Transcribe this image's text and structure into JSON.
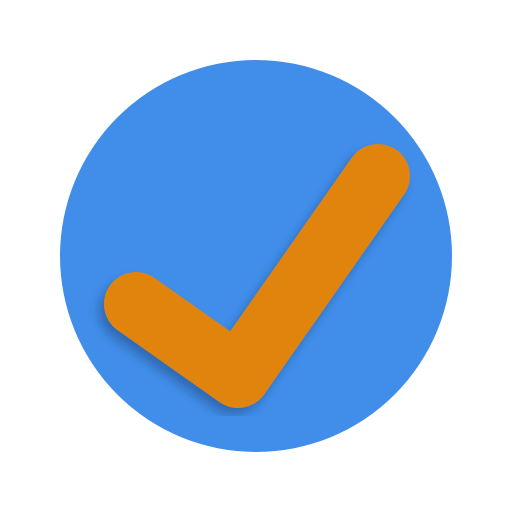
{
  "icon": {
    "name": "checkmark-circle-icon",
    "background_color": "#ffffff",
    "circle_color": "#418EEA",
    "check_color": "#E0840A",
    "shadow_color": "#1B3F73"
  }
}
